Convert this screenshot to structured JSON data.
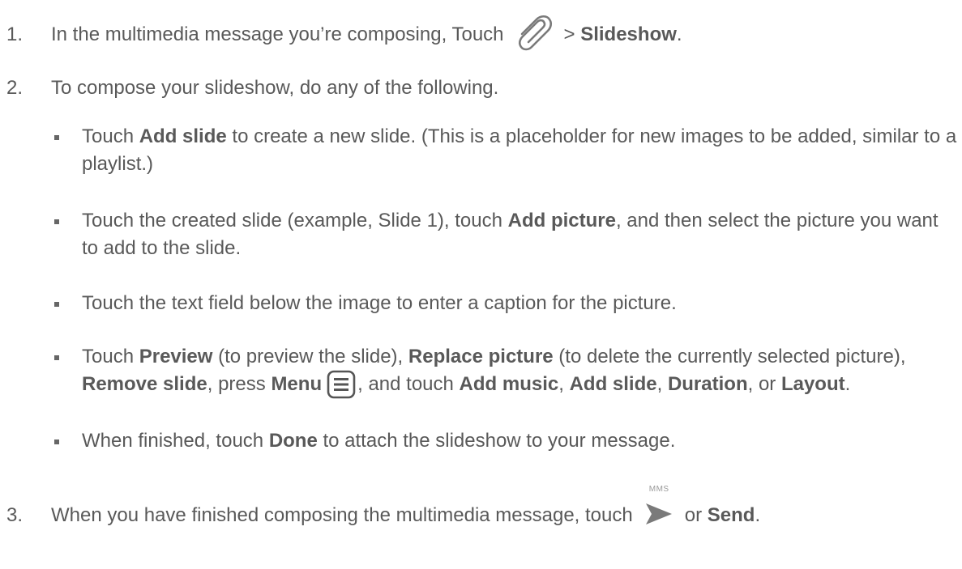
{
  "steps": [
    {
      "number": "1.",
      "text_before": "In the multimedia message you’re composing, Touch",
      "icon": "paperclip-icon",
      "text_mid": "> ",
      "bold": "Slideshow",
      "text_after": "."
    },
    {
      "number": "2.",
      "text": "To compose your slideshow, do any of the following."
    },
    {
      "number": "3.",
      "text_before": "When you have finished composing the multimedia message, touch",
      "icon": "send-icon",
      "icon_caption": "MMS",
      "text_mid": "or ",
      "bold": "Send",
      "text_after": "."
    }
  ],
  "bullets": {
    "b1": {
      "t1": "Touch ",
      "bold1": "Add slide",
      "t2": " to create a new slide. (This is a placeholder for new images to be added, similar to a playlist.)"
    },
    "b2": {
      "t1": "Touch the created slide (example, Slide 1), touch ",
      "bold1": "Add picture",
      "t2": ", and then select the picture you want to add to the slide."
    },
    "b3": {
      "t1": "Touch the text field below the image to enter a caption for the picture."
    },
    "b4": {
      "t1": "Touch ",
      "bold1": "Preview",
      "t2": " (to preview the slide), ",
      "bold2": "Replace picture",
      "t3": " (to delete the currently selected picture), ",
      "bold3": "Remove slide",
      "t4": ", press ",
      "bold4": "Menu",
      "icon": "menu-icon",
      "t5": ", and touch ",
      "bold5": "Add music",
      "t6": ", ",
      "bold6": "Add slide",
      "t7": ", ",
      "bold7": "Duration",
      "t8": ", or ",
      "bold8": "Layout",
      "t9": "."
    },
    "b5": {
      "t1": "When finished, touch ",
      "bold1": "Done",
      "t2": " to attach the slideshow to your message."
    }
  },
  "colors": {
    "text": "#595959",
    "icon": "#7a7a7a"
  }
}
